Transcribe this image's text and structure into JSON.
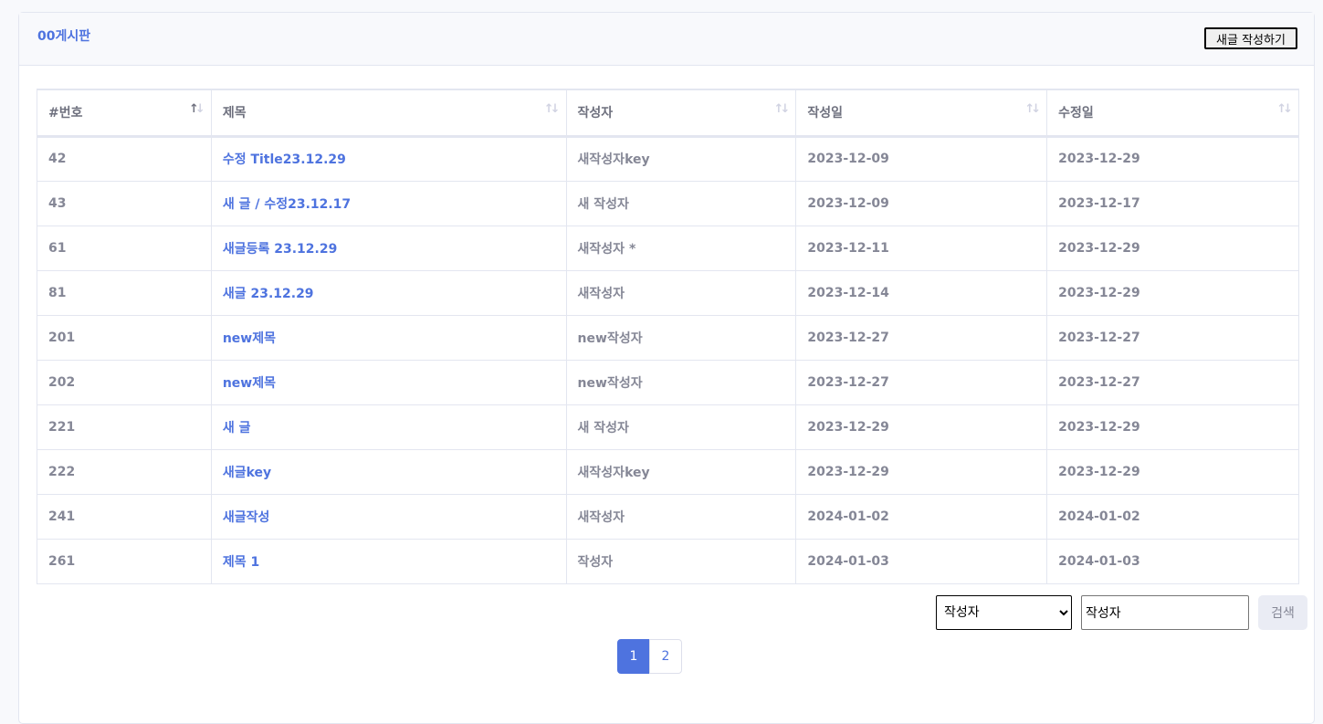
{
  "header": {
    "title": "00게시판",
    "new_post_label": "새글 작성하기"
  },
  "table": {
    "columns": [
      "#번호",
      "제목",
      "작성자",
      "작성일",
      "수정일"
    ],
    "sort_icon": "↑↓",
    "rows": [
      {
        "id": "42",
        "title": "수정 Title23.12.29",
        "author": "새작성자key",
        "created": "2023-12-09",
        "modified": "2023-12-29"
      },
      {
        "id": "43",
        "title": "새 글 / 수정23.12.17",
        "author": "새 작성자",
        "created": "2023-12-09",
        "modified": "2023-12-17"
      },
      {
        "id": "61",
        "title": "새글등록 23.12.29",
        "author": "새작성자 *",
        "created": "2023-12-11",
        "modified": "2023-12-29"
      },
      {
        "id": "81",
        "title": "새글 23.12.29",
        "author": "새작성자",
        "created": "2023-12-14",
        "modified": "2023-12-29"
      },
      {
        "id": "201",
        "title": "new제목",
        "author": "new작성자",
        "created": "2023-12-27",
        "modified": "2023-12-27"
      },
      {
        "id": "202",
        "title": "new제목",
        "author": "new작성자",
        "created": "2023-12-27",
        "modified": "2023-12-27"
      },
      {
        "id": "221",
        "title": "새 글",
        "author": "새 작성자",
        "created": "2023-12-29",
        "modified": "2023-12-29"
      },
      {
        "id": "222",
        "title": "새글key",
        "author": "새작성자key",
        "created": "2023-12-29",
        "modified": "2023-12-29"
      },
      {
        "id": "241",
        "title": "새글작성",
        "author": "새작성자",
        "created": "2024-01-02",
        "modified": "2024-01-02"
      },
      {
        "id": "261",
        "title": "제목 1",
        "author": "작성자",
        "created": "2024-01-03",
        "modified": "2024-01-03"
      }
    ]
  },
  "search": {
    "field_selected": "작성자",
    "query_value": "작성자",
    "button_label": "검색"
  },
  "pagination": {
    "pages": [
      "1",
      "2"
    ],
    "active": "1"
  },
  "colors": {
    "accent": "#4e73df",
    "text": "#858796",
    "border": "#e3e6f0"
  }
}
